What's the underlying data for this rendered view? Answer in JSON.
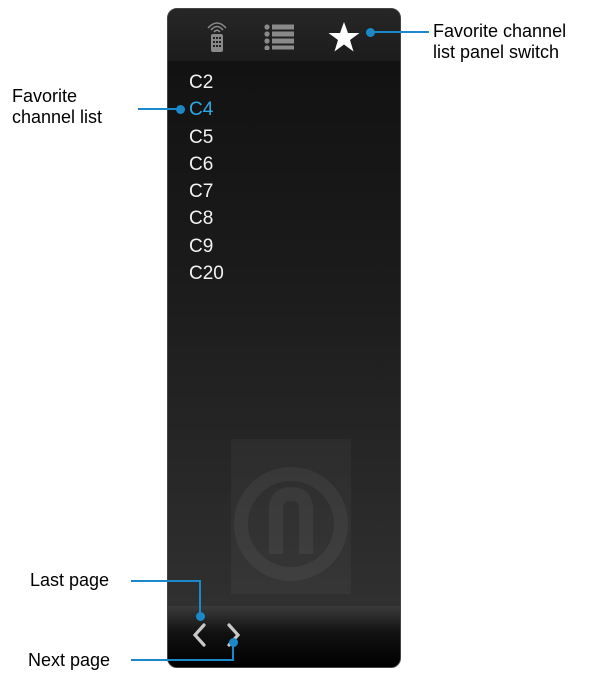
{
  "callouts": {
    "favorite_list": [
      "Favorite",
      "channel list"
    ],
    "panel_switch": [
      "Favorite channel",
      "list panel switch"
    ],
    "last_page": "Last page",
    "next_page": "Next page"
  },
  "channels": [
    {
      "label": "C2",
      "selected": false
    },
    {
      "label": "C4",
      "selected": true
    },
    {
      "label": "C5",
      "selected": false
    },
    {
      "label": "C6",
      "selected": false
    },
    {
      "label": "C7",
      "selected": false
    },
    {
      "label": "C8",
      "selected": false
    },
    {
      "label": "C9",
      "selected": false
    },
    {
      "label": "C20",
      "selected": false
    }
  ],
  "toolbar": {
    "icons": [
      "remote-icon",
      "list-icon",
      "star-icon"
    ],
    "active": "star-icon"
  },
  "colors": {
    "accent": "#1b89c9",
    "selected_text": "#2ea9e6",
    "panel": "#1d1d1d"
  }
}
